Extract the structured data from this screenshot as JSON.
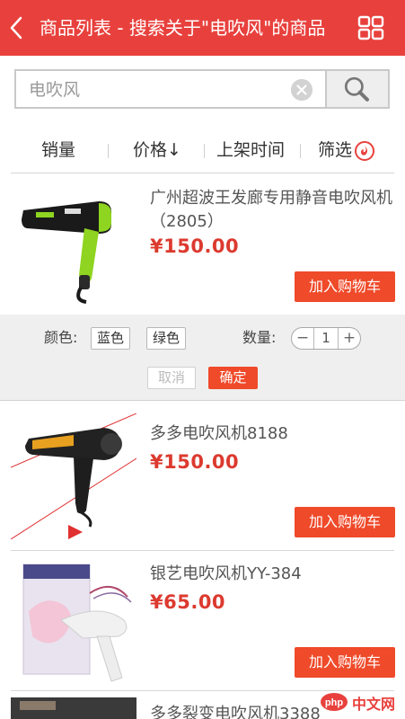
{
  "header": {
    "title": "商品列表 - 搜索关于\"电吹风\"的商品",
    "back_icon": "chevron-left-icon",
    "menu_icon": "grid-icon",
    "color": "#e8413d"
  },
  "search": {
    "value": "",
    "placeholder": "电吹风"
  },
  "sort": {
    "items": [
      {
        "label": "销量"
      },
      {
        "label": "价格↓"
      },
      {
        "label": "上架时间"
      },
      {
        "label": "筛选"
      }
    ]
  },
  "products": [
    {
      "name": "广州超波王发廊专用静音电吹风机（2805）",
      "price": "¥150.00",
      "cart_label": "加入购物车"
    },
    {
      "name": "多多电吹风机8188",
      "price": "¥150.00",
      "cart_label": "加入购物车"
    },
    {
      "name": "银艺电吹风机YY-384",
      "price": "¥65.00",
      "cart_label": "加入购物车"
    },
    {
      "name": "多多裂变电吹风机3388"
    }
  ],
  "options": {
    "color_label": "颜色:",
    "colors": [
      "蓝色",
      "绿色"
    ],
    "quantity_label": "数量:",
    "quantity": "1",
    "cancel_label": "取消",
    "confirm_label": "确定"
  },
  "watermark": {
    "text": "中文网",
    "logo": "php"
  },
  "colors": {
    "accent": "#e8413d",
    "price": "#dc3a2f",
    "button": "#ef4a2a"
  }
}
